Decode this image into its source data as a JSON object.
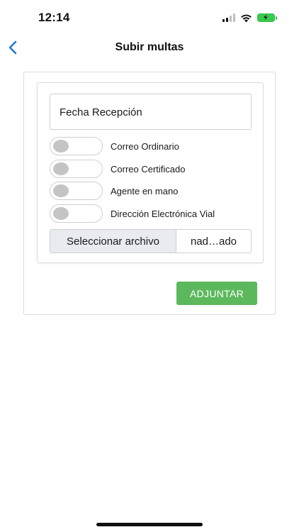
{
  "status_bar": {
    "time": "12:14",
    "icons": [
      "cellular-signal-icon",
      "wifi-icon",
      "battery-charging-icon"
    ],
    "battery_color": "#38c94e"
  },
  "nav": {
    "back_icon": "chevron-left-icon",
    "title": "Subir multas",
    "accent_color": "#1a7bd6"
  },
  "form": {
    "date_field": {
      "placeholder": "Fecha Recepción"
    },
    "toggles": [
      {
        "label": "Correo Ordinario",
        "on": false
      },
      {
        "label": "Correo Certificado",
        "on": false
      },
      {
        "label": "Agente en mano",
        "on": false
      },
      {
        "label": "Dirección Electrónica Vial",
        "on": false
      }
    ],
    "file": {
      "button_label": "Seleccionar archivo",
      "file_name": "nad…ado"
    }
  },
  "actions": {
    "attach_label": "ADJUNTAR",
    "attach_color": "#5cb85c"
  }
}
